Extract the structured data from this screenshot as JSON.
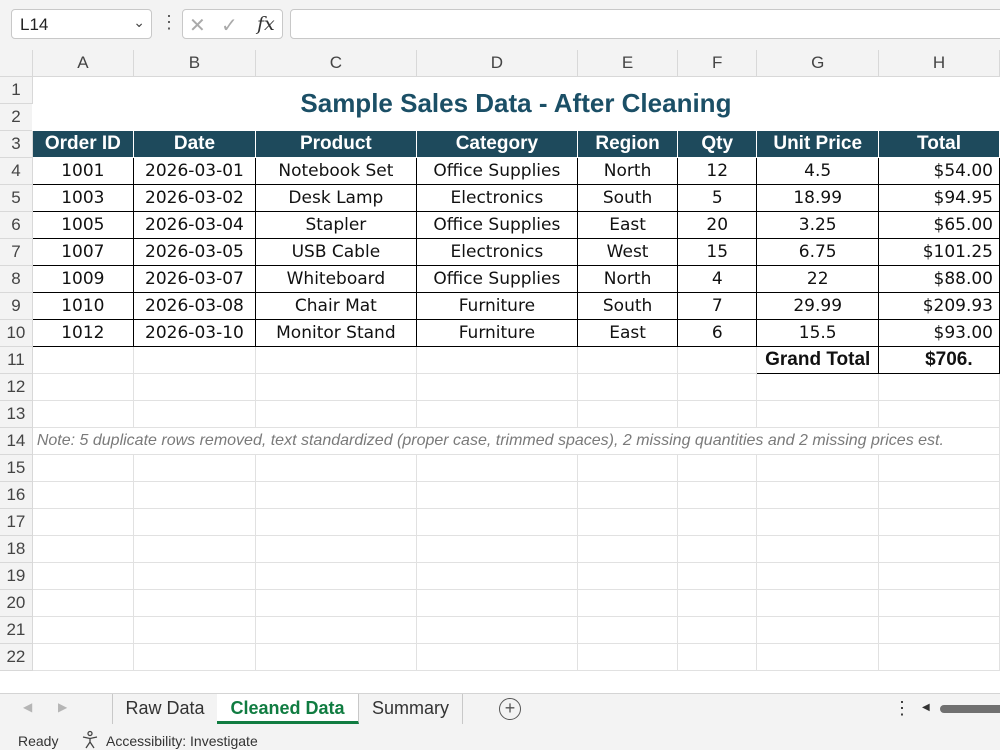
{
  "formula_bar": {
    "name_box": "L14",
    "name_box_dropdown": "⌄",
    "more_dots": "⋮",
    "cancel_glyph": "✕",
    "enter_glyph": "✓",
    "fx_glyph": "fx",
    "formula_value": ""
  },
  "columns": [
    "A",
    "B",
    "C",
    "D",
    "E",
    "F",
    "G",
    "H"
  ],
  "rows": [
    "1",
    "2",
    "3",
    "4",
    "5",
    "6",
    "7",
    "8",
    "9",
    "10",
    "11",
    "12",
    "13",
    "14",
    "15",
    "16",
    "17",
    "18",
    "19",
    "20",
    "21",
    "22"
  ],
  "sheet": {
    "title": "Sample Sales Data - After Cleaning",
    "headers": [
      "Order ID",
      "Date",
      "Product",
      "Category",
      "Region",
      "Qty",
      "Unit Price",
      "Total"
    ],
    "records": [
      [
        "1001",
        "2026-03-01",
        "Notebook Set",
        "Office Supplies",
        "North",
        "12",
        "4.5",
        "$54.00"
      ],
      [
        "1003",
        "2026-03-02",
        "Desk Lamp",
        "Electronics",
        "South",
        "5",
        "18.99",
        "$94.95"
      ],
      [
        "1005",
        "2026-03-04",
        "Stapler",
        "Office Supplies",
        "East",
        "20",
        "3.25",
        "$65.00"
      ],
      [
        "1007",
        "2026-03-05",
        "USB Cable",
        "Electronics",
        "West",
        "15",
        "6.75",
        "$101.25"
      ],
      [
        "1009",
        "2026-03-07",
        "Whiteboard",
        "Office Supplies",
        "North",
        "4",
        "22",
        "$88.00"
      ],
      [
        "1010",
        "2026-03-08",
        "Chair Mat",
        "Furniture",
        "South",
        "7",
        "29.99",
        "$209.93"
      ],
      [
        "1012",
        "2026-03-10",
        "Monitor Stand",
        "Furniture",
        "East",
        "6",
        "15.5",
        "$93.00"
      ]
    ],
    "grand_total_label": "Grand Total",
    "grand_total_value": "$706.",
    "note": "Note: 5 duplicate rows removed, text standardized (proper case, trimmed spaces), 2 missing quantities and 2 missing prices est."
  },
  "sheet_tabs": {
    "prev": "◀",
    "next": "▶",
    "tabs": [
      "Raw Data",
      "Cleaned Data",
      "Summary"
    ],
    "active_tab": "Cleaned Data",
    "add_glyph": "+",
    "more_dots": "⋮",
    "scroll_left": "◀"
  },
  "status_bar": {
    "ready": "Ready",
    "accessibility": "Accessibility: Investigate"
  },
  "colors": {
    "header_fill": "#1e4a5c",
    "title_text": "#1b4f66",
    "active_tab": "#107c41",
    "note_text": "#7a7a7a"
  }
}
